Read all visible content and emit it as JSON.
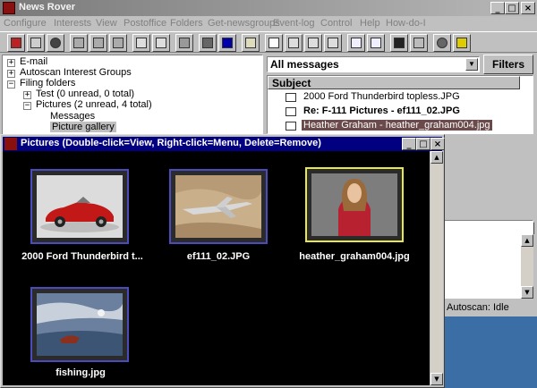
{
  "window": {
    "title": "News Rover"
  },
  "menu": [
    "Configure",
    "Interests",
    "View",
    "Postoffice",
    "Folders",
    "Get-newsgroups",
    "Event-log",
    "Control",
    "Help",
    "How-do-I"
  ],
  "tree": {
    "items": [
      {
        "label": "E-mail",
        "sign": "+"
      },
      {
        "label": "Autoscan Interest Groups",
        "sign": "+"
      },
      {
        "label": "Filing folders",
        "sign": "−"
      },
      {
        "label": "Test (0 unread, 0 total)",
        "sign": "+"
      },
      {
        "label": "Pictures (2 unread, 4 total)",
        "sign": "−"
      },
      {
        "label": "Messages",
        "sign": ""
      },
      {
        "label": "Picture gallery",
        "sign": ""
      }
    ]
  },
  "filter": {
    "selected": "All messages",
    "button": "Filters"
  },
  "messages": {
    "header": "Subject",
    "rows": [
      {
        "subject": "2000 Ford Thunderbird topless.JPG",
        "unread": false,
        "selected": false
      },
      {
        "subject": "Re: F-111 Pictures - ef111_02.JPG",
        "unread": true,
        "selected": false
      },
      {
        "subject": "Heather Graham - heather_graham004.jpg",
        "unread": false,
        "selected": true
      }
    ]
  },
  "status": {
    "text": "Autoscan: Idle"
  },
  "pictures": {
    "title": "Pictures  (Double-click=View, Right-click=Menu, Delete=Remove)",
    "thumbs": [
      {
        "caption": "2000 Ford Thunderbird t...",
        "selected": false
      },
      {
        "caption": "ef111_02.JPG",
        "selected": false
      },
      {
        "caption": "heather_graham004.jpg",
        "selected": true
      },
      {
        "caption": "fishing.jpg",
        "selected": false
      }
    ]
  },
  "icons": {
    "app": "rover-icon",
    "thumb_car": "car-image",
    "thumb_jet": "jet-image",
    "thumb_person": "portrait-image",
    "thumb_fish": "painting-image"
  },
  "colors": {
    "titlebar_active": "#000080",
    "selection": "#6a4a4a",
    "thumb_border": "#4b4bbb",
    "thumb_selected": "#e8e84a"
  }
}
